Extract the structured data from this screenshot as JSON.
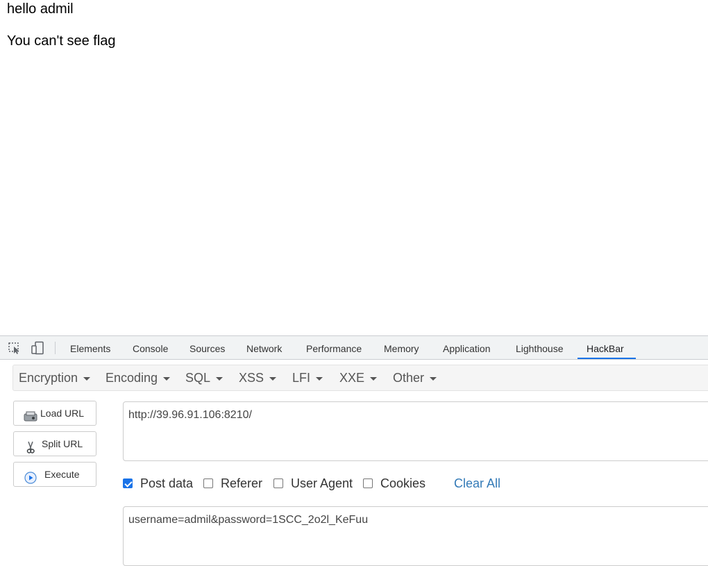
{
  "page": {
    "line1": "hello admil",
    "line2": "You can't see flag"
  },
  "devtools": {
    "tabs": [
      "Elements",
      "Console",
      "Sources",
      "Network",
      "Performance",
      "Memory",
      "Application",
      "Lighthouse",
      "HackBar"
    ],
    "active_tab": "HackBar",
    "icons": [
      "inspect-element-icon",
      "device-toolbar-icon"
    ]
  },
  "hackbar": {
    "menus": [
      "Encryption",
      "Encoding",
      "SQL",
      "XSS",
      "LFI",
      "XXE",
      "Other"
    ],
    "buttons": {
      "load_url": "Load URL",
      "split_url": "Split URL",
      "execute": "Execute"
    },
    "url_value": "http://39.96.91.106:8210/",
    "options": {
      "post_data": "Post data",
      "referer": "Referer",
      "user_agent": "User Agent",
      "cookies": "Cookies"
    },
    "options_checked": {
      "post_data": true,
      "referer": false,
      "user_agent": false,
      "cookies": false
    },
    "clear_all": "Clear All",
    "post_value": "username=admil&password=1SCC_2o2l_KeFuu"
  },
  "colors": {
    "accent": "#1a73e8",
    "link": "#337ab7",
    "tabbar_bg": "#f1f3f4"
  }
}
